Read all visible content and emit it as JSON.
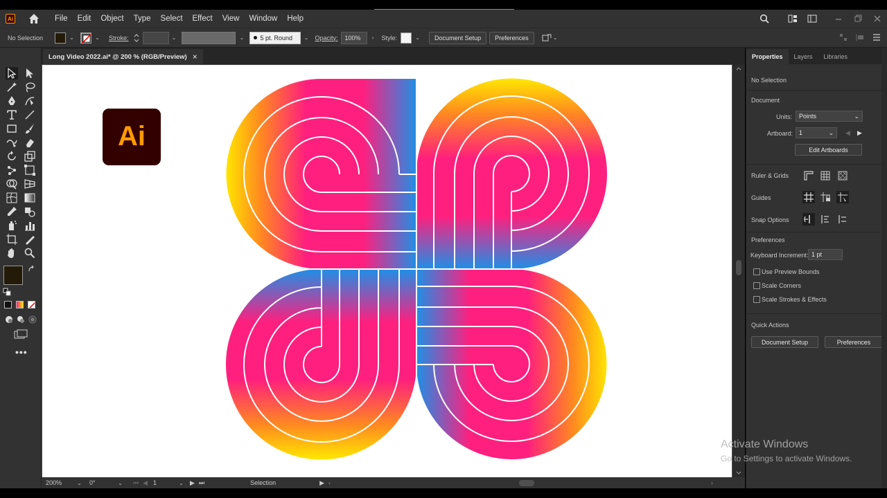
{
  "app": {
    "badge": "Ai"
  },
  "menu": [
    "File",
    "Edit",
    "Object",
    "Type",
    "Select",
    "Effect",
    "View",
    "Window",
    "Help"
  ],
  "control": {
    "selection": "No Selection",
    "stroke_label": "Stroke:",
    "brush": "5 pt. Round",
    "opacity_label": "Opacity:",
    "opacity": "100%",
    "style_label": "Style:",
    "document_setup": "Document Setup",
    "preferences": "Preferences"
  },
  "document": {
    "tab_title": "Long Video 2022.ai* @ 200 % (RGB/Preview)",
    "close": "×"
  },
  "artwork": {
    "logo_text": "Ai",
    "colors": {
      "pink": "#ff1f7e",
      "yellow": "#ffe600",
      "blue": "#1f8fe6",
      "orange": "#ff8a20"
    }
  },
  "status": {
    "zoom": "200%",
    "rotation": "0°",
    "artboard": "1",
    "tool": "Selection"
  },
  "panel": {
    "tabs": [
      "Properties",
      "Layers",
      "Libraries"
    ],
    "no_selection": "No Selection",
    "document_heading": "Document",
    "units_label": "Units:",
    "units_value": "Points",
    "artboard_label": "Artboard:",
    "artboard_value": "1",
    "edit_artboards": "Edit Artboards",
    "ruler_grids": "Ruler & Grids",
    "guides": "Guides",
    "snap_options": "Snap Options",
    "preferences_heading": "Preferences",
    "keyboard_increment_label": "Keyboard Increment:",
    "keyboard_increment_value": "1 pt",
    "use_preview_bounds": "Use Preview Bounds",
    "scale_corners": "Scale Corners",
    "scale_strokes": "Scale Strokes & Effects",
    "quick_actions": "Quick Actions",
    "qa_document_setup": "Document Setup",
    "qa_preferences": "Preferences"
  },
  "watermark": {
    "line1": "Activate Windows",
    "line2": "Go to Settings to activate Windows."
  }
}
